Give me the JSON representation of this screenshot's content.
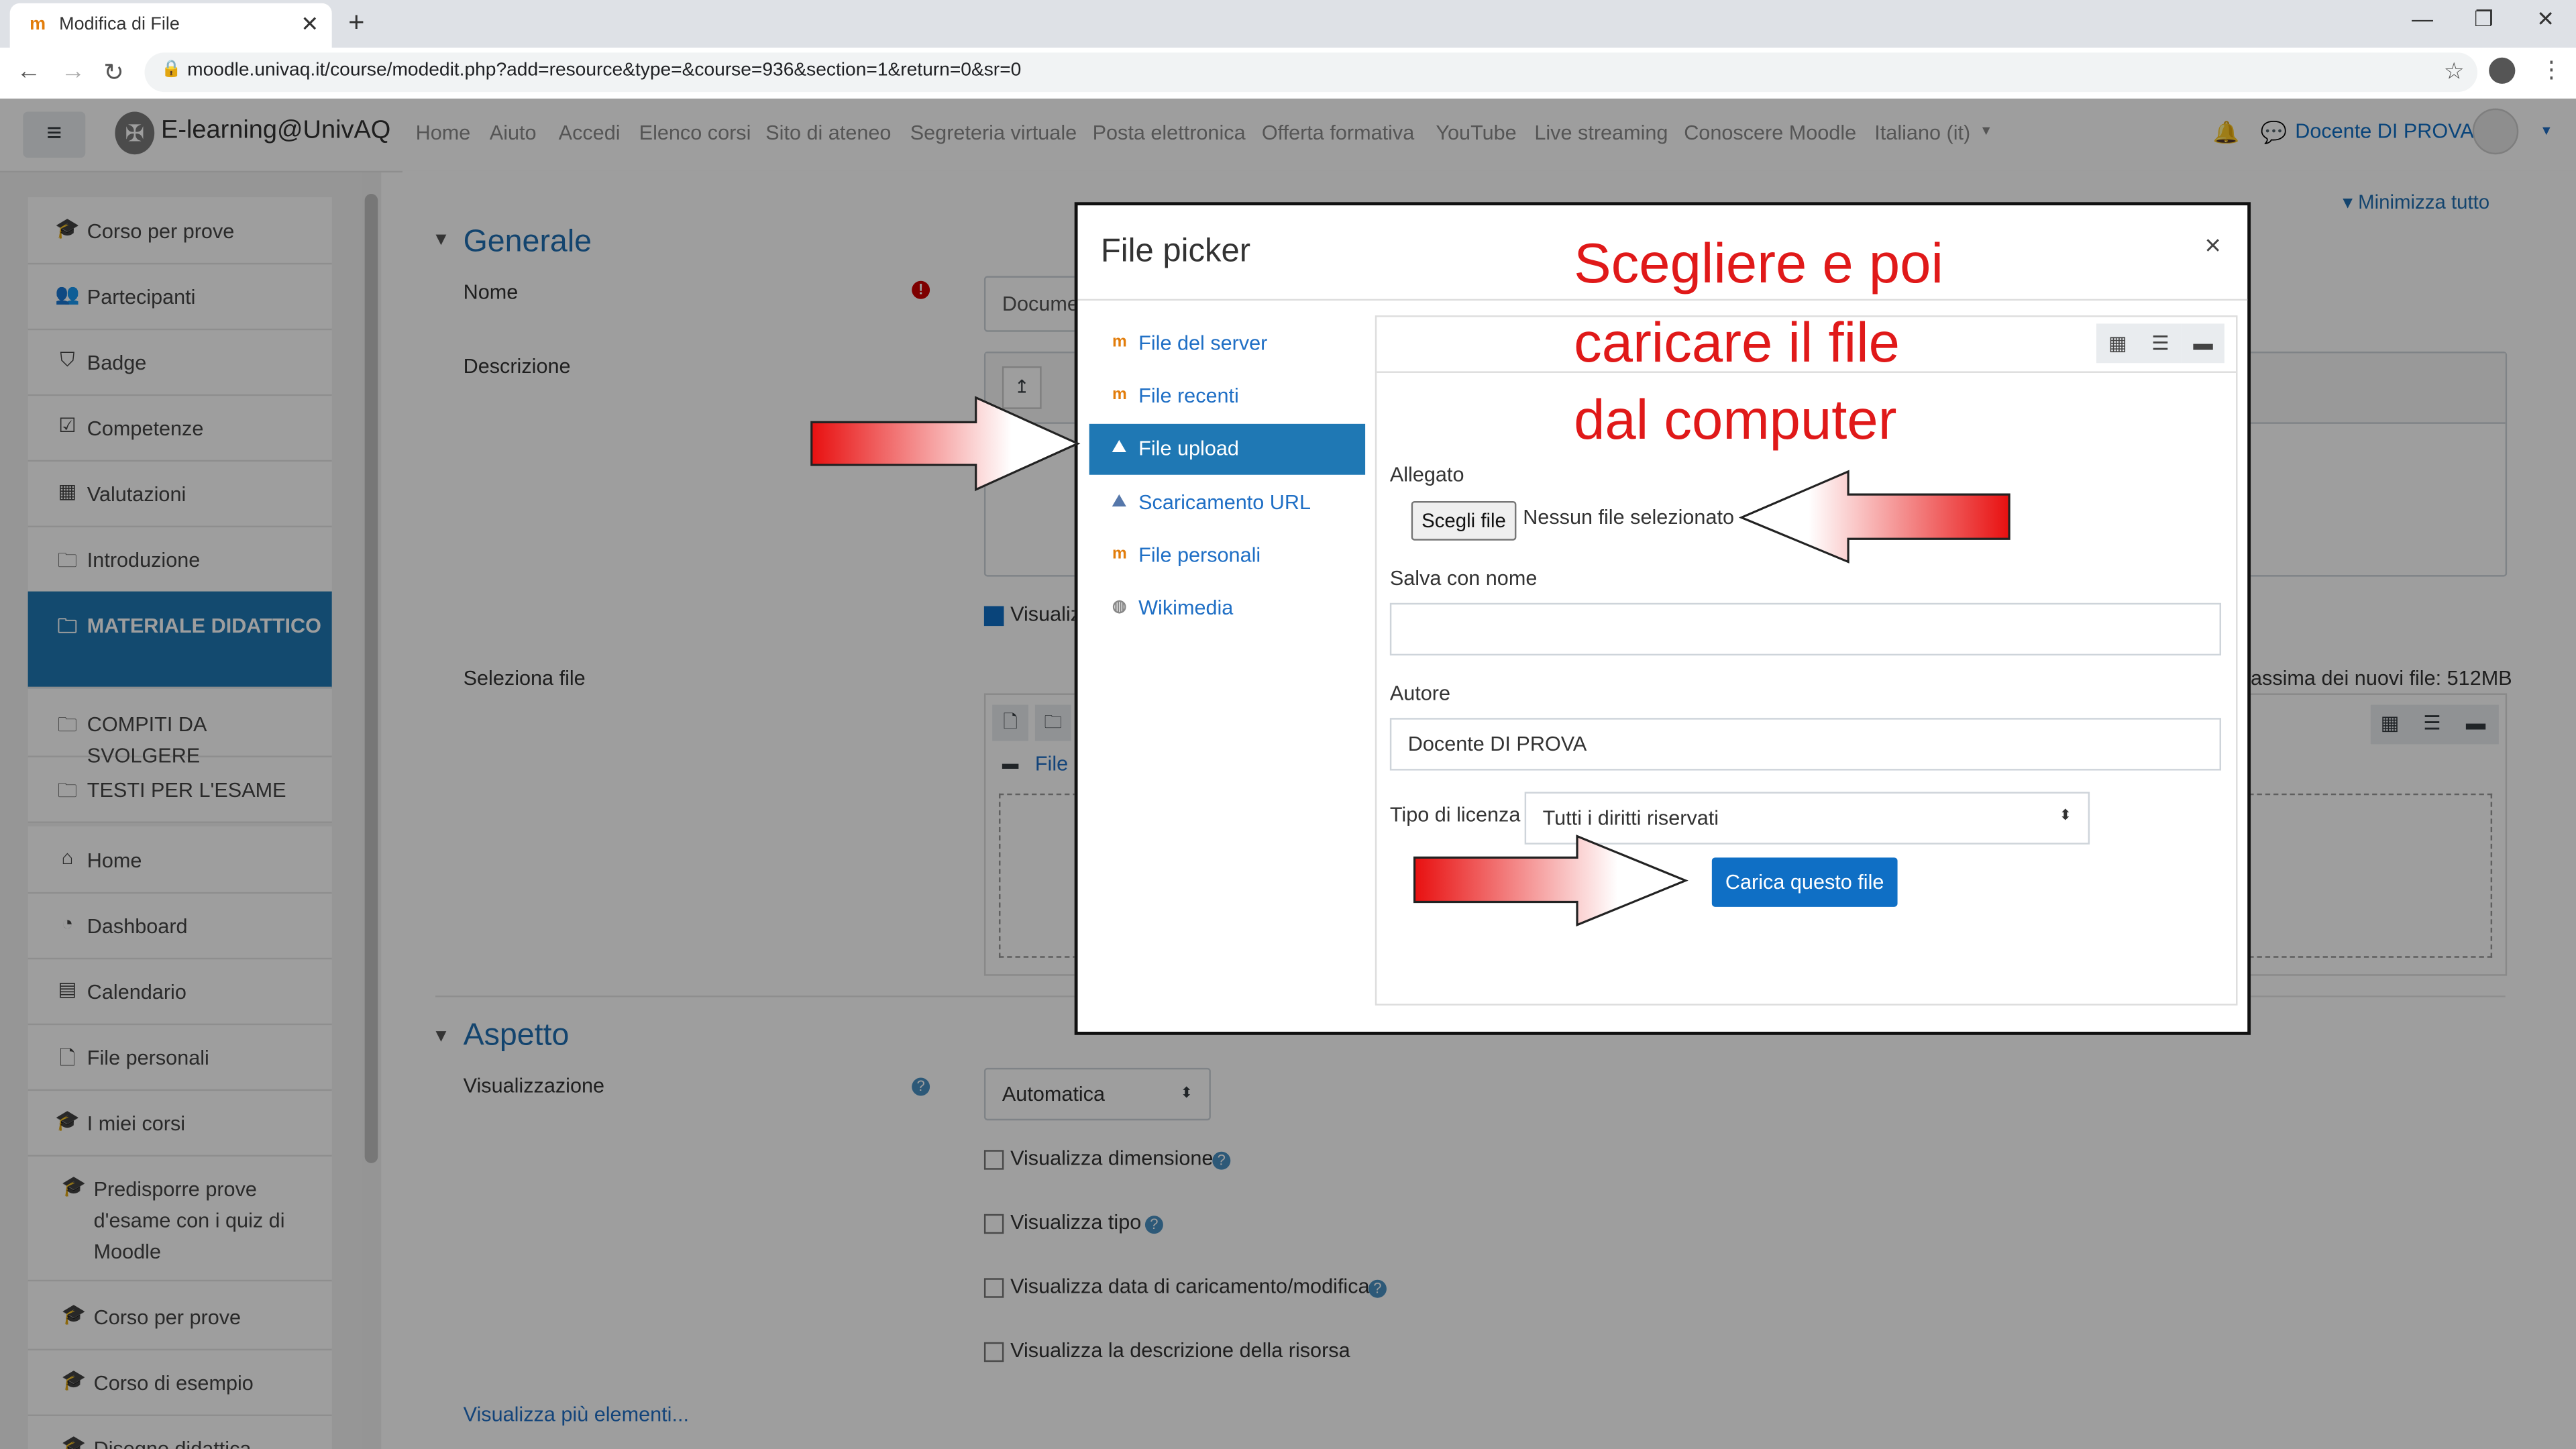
{
  "browser": {
    "tab_title": "Modifica di File",
    "tab_favicon": "moodle-icon",
    "url": "moodle.univaq.it/course/modedit.php?add=resource&type=&course=936&section=1&return=0&sr=0"
  },
  "navbar": {
    "site_name": "E-learning@UnivAQ",
    "links": [
      "Home",
      "Aiuto",
      "Accedi",
      "Elenco corsi",
      "Sito di ateneo",
      "Segreteria virtuale",
      "Posta elettronica",
      "Offerta formativa",
      "YouTube",
      "Live streaming",
      "Conoscere Moodle"
    ],
    "language": "Italiano (it)",
    "user": "Docente DI PROVA"
  },
  "sidebar": {
    "course_items": [
      {
        "icon": "graduation-cap-icon",
        "label": "Corso per prove"
      },
      {
        "icon": "users-icon",
        "label": "Partecipanti"
      },
      {
        "icon": "shield-icon",
        "label": "Badge"
      },
      {
        "icon": "checkbox-icon",
        "label": "Competenze"
      },
      {
        "icon": "table-icon",
        "label": "Valutazioni"
      },
      {
        "icon": "folder-icon",
        "label": "Introduzione"
      },
      {
        "icon": "folder-icon",
        "label": "MATERIALE DIDATTICO",
        "active": true
      },
      {
        "icon": "folder-icon",
        "label": "COMPITI DA SVOLGERE"
      },
      {
        "icon": "folder-icon",
        "label": "TESTI PER L'ESAME"
      }
    ],
    "site_items": [
      {
        "icon": "home-icon",
        "label": "Home"
      },
      {
        "icon": "dashboard-icon",
        "label": "Dashboard"
      },
      {
        "icon": "calendar-icon",
        "label": "Calendario"
      },
      {
        "icon": "file-icon",
        "label": "File personali"
      },
      {
        "icon": "graduation-cap-icon",
        "label": "I miei corsi"
      },
      {
        "icon": "graduation-cap-icon",
        "label": "Predisporre prove d'esame con i quiz di Moodle"
      },
      {
        "icon": "graduation-cap-icon",
        "label": "Corso per prove"
      },
      {
        "icon": "graduation-cap-icon",
        "label": "Corso di esempio"
      },
      {
        "icon": "graduation-cap-icon",
        "label": "Disegno didattica"
      }
    ]
  },
  "form": {
    "collapse_all": "Minimizza tutto",
    "general_header": "Generale",
    "name_label": "Nome",
    "name_value": "Docume",
    "description_label": "Descrizione",
    "show_desc_partial": "Visualiz",
    "select_files_label": "Seleziona file",
    "max_size_partial": "nassima dei nuovi file: 512MB",
    "file_folder_label": "File",
    "appearance_header": "Aspetto",
    "display_label": "Visualizzazione",
    "display_value": "Automatica",
    "options": [
      "Visualizza dimensione",
      "Visualizza tipo",
      "Visualizza data di caricamento/modifica",
      "Visualizza la descrizione della risorsa"
    ],
    "show_more": "Visualizza più elementi..."
  },
  "file_picker": {
    "title": "File picker",
    "close": "×",
    "repositories": [
      {
        "label": "File del server",
        "icon": "moodle-icon"
      },
      {
        "label": "File recenti",
        "icon": "moodle-icon"
      },
      {
        "label": "File upload",
        "icon": "upload-icon",
        "active": true
      },
      {
        "label": "Scaricamento URL",
        "icon": "download-icon"
      },
      {
        "label": "File personali",
        "icon": "moodle-icon"
      },
      {
        "label": "Wikimedia",
        "icon": "wikimedia-icon"
      }
    ],
    "attachment_label": "Allegato",
    "choose_button": "Scegli file",
    "no_file": "Nessun file selezionato",
    "save_as_label": "Salva con nome",
    "save_as_value": "",
    "author_label": "Autore",
    "author_value": "Docente DI PROVA",
    "license_label": "Tipo di licenza",
    "license_value": "Tutti i diritti riservati",
    "upload_button": "Carica questo file"
  },
  "annotation": {
    "lines": [
      "Scegliere e poi",
      "caricare  il  file",
      "dal computer"
    ],
    "color": "#e01919"
  }
}
